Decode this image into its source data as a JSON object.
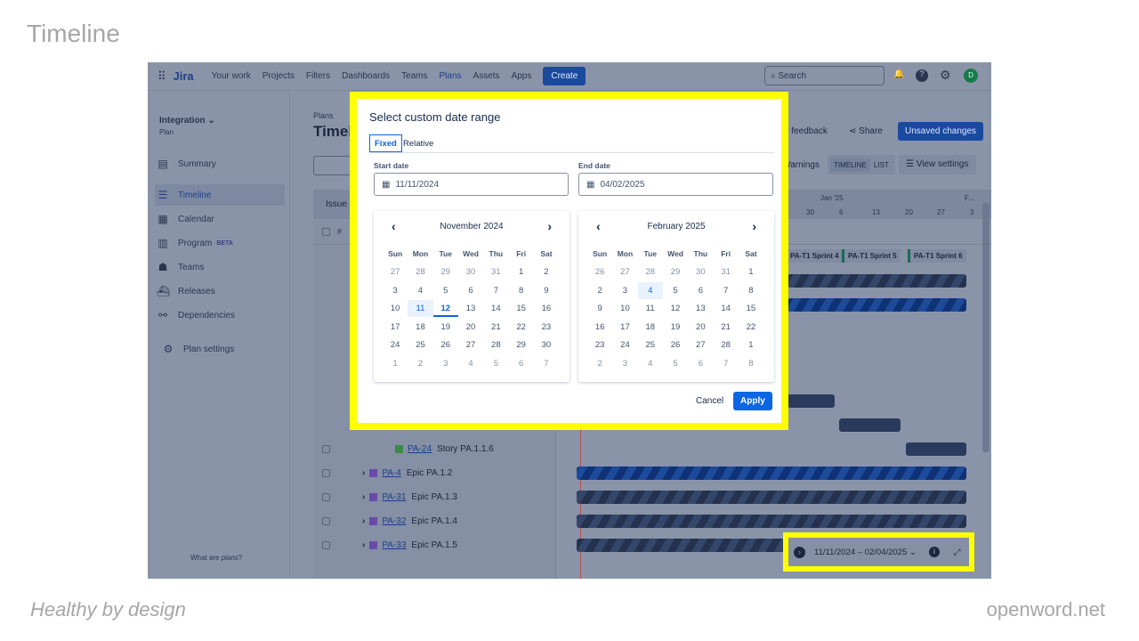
{
  "slide": {
    "title": "Timeline",
    "footer_left": "Healthy by design",
    "footer_right": "openword.net"
  },
  "topbar": {
    "logo": "Jira",
    "nav": [
      "Your work",
      "Projects",
      "Filters",
      "Dashboards",
      "Teams",
      "Plans",
      "Assets",
      "Apps"
    ],
    "active": "Plans",
    "create": "Create",
    "search_placeholder": "Search",
    "avatar": "D"
  },
  "sidebar": {
    "plan_name": "Integration",
    "plan_type": "Plan",
    "items": [
      {
        "label": "Summary",
        "icon": "summary-icon"
      },
      {
        "label": "Timeline",
        "icon": "timeline-icon",
        "active": true
      },
      {
        "label": "Calendar",
        "icon": "calendar-icon"
      },
      {
        "label": "Program",
        "icon": "program-icon",
        "badge": "BETA"
      },
      {
        "label": "Teams",
        "icon": "teams-icon"
      },
      {
        "label": "Releases",
        "icon": "releases-icon"
      },
      {
        "label": "Dependencies",
        "icon": "dependencies-icon"
      }
    ],
    "settings": "Plan settings",
    "footer": "What are plans?"
  },
  "page": {
    "breadcrumb": "Plans",
    "title": "Timeline",
    "feedback": "Give feedback",
    "share": "Share",
    "unsaved": "Unsaved changes",
    "warnings": "Warnings",
    "view_timeline": "TIMELINE",
    "view_list": "LIST",
    "view_settings": "View settings",
    "issue_col": "Issue",
    "hash_col": "#"
  },
  "timeline": {
    "month_labels": [
      "Jan '25",
      "F..."
    ],
    "week_labels": [
      "30",
      "6",
      "13",
      "20",
      "27",
      "3"
    ],
    "sprints": [
      "PA-T1 Sprint 4",
      "PA-T1 Sprint 5",
      "PA-T1 Sprint 6"
    ]
  },
  "issues": [
    {
      "key": "PA-24",
      "summary": "Story PA.1.1.6",
      "type": "story"
    },
    {
      "key": "PA-4",
      "summary": "Epic PA.1.2",
      "type": "epic"
    },
    {
      "key": "PA-31",
      "summary": "Epic PA.1.3",
      "type": "epic"
    },
    {
      "key": "PA-32",
      "summary": "Epic PA.1.4",
      "type": "epic"
    },
    {
      "key": "PA-33",
      "summary": "Epic PA.1.5",
      "type": "epic"
    }
  ],
  "date_range_bar": {
    "range": "11/11/2024 – 02/04/2025"
  },
  "modal": {
    "title": "Select custom date range",
    "tabs": [
      "Fixed",
      "Relative"
    ],
    "active_tab": "Fixed",
    "start_label": "Start date",
    "start_value": "11/11/2024",
    "end_label": "End date",
    "end_value": "04/02/2025",
    "cancel": "Cancel",
    "apply": "Apply",
    "weekdays": [
      "Sun",
      "Mon",
      "Tue",
      "Wed",
      "Thu",
      "Fri",
      "Sat"
    ],
    "calendars": [
      {
        "month": "November 2024",
        "days": [
          "27",
          "28",
          "29",
          "30",
          "31",
          "1",
          "2",
          "3",
          "4",
          "5",
          "6",
          "7",
          "8",
          "9",
          "10",
          "11",
          "12",
          "13",
          "14",
          "15",
          "16",
          "17",
          "18",
          "19",
          "20",
          "21",
          "22",
          "23",
          "24",
          "25",
          "26",
          "27",
          "28",
          "29",
          "30",
          "1",
          "2",
          "3",
          "4",
          "5",
          "6",
          "7"
        ],
        "selected": "11",
        "today": "12",
        "lead": 5,
        "trail": 7
      },
      {
        "month": "February 2025",
        "days": [
          "26",
          "27",
          "28",
          "29",
          "30",
          "31",
          "1",
          "2",
          "3",
          "4",
          "5",
          "6",
          "7",
          "8",
          "9",
          "10",
          "11",
          "12",
          "13",
          "14",
          "15",
          "16",
          "17",
          "18",
          "19",
          "20",
          "21",
          "22",
          "23",
          "24",
          "25",
          "26",
          "27",
          "28",
          "1",
          "2",
          "3",
          "4",
          "5",
          "6",
          "7",
          "8"
        ],
        "selected": "4",
        "lead": 6,
        "trail": 8
      }
    ]
  },
  "colors": {
    "highlight": "#ffff00",
    "primary": "#0c66e4",
    "overlay": "#8a94a8"
  }
}
